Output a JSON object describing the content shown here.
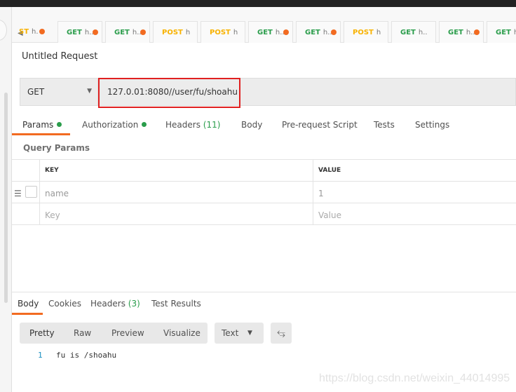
{
  "tabs": [
    {
      "method": "ST",
      "url": "h.",
      "dot": true,
      "type": "post"
    },
    {
      "method": "GET",
      "url": "h...",
      "dot": true,
      "type": "get"
    },
    {
      "method": "GET",
      "url": "h...",
      "dot": true,
      "type": "get"
    },
    {
      "method": "POST",
      "url": "h",
      "dot": false,
      "type": "post"
    },
    {
      "method": "POST",
      "url": "h",
      "dot": false,
      "type": "post"
    },
    {
      "method": "GET",
      "url": "h...",
      "dot": true,
      "type": "get"
    },
    {
      "method": "GET",
      "url": "h...",
      "dot": true,
      "type": "get"
    },
    {
      "method": "POST",
      "url": "h",
      "dot": false,
      "type": "post"
    },
    {
      "method": "GET",
      "url": "h..",
      "dot": false,
      "type": "get"
    },
    {
      "method": "GET",
      "url": "h...",
      "dot": true,
      "type": "get"
    },
    {
      "method": "GET",
      "url": "h",
      "dot": false,
      "type": "get"
    }
  ],
  "request": {
    "title": "Untitled Request",
    "method": "GET",
    "url": "127.0.01:8080//user/fu/shoahu"
  },
  "req_tabs": {
    "params": "Params",
    "authorization": "Authorization",
    "headers": "Headers",
    "headers_count": "(11)",
    "body": "Body",
    "prescript": "Pre-request Script",
    "tests": "Tests",
    "settings": "Settings"
  },
  "query": {
    "title": "Query Params",
    "col_key": "KEY",
    "col_value": "VALUE",
    "rows": [
      {
        "key": "name",
        "value": "1"
      }
    ],
    "key_placeholder": "Key",
    "value_placeholder": "Value"
  },
  "response": {
    "tabs": {
      "body": "Body",
      "cookies": "Cookies",
      "headers": "Headers",
      "headers_count": "(3)",
      "tests": "Test Results"
    },
    "views": {
      "pretty": "Pretty",
      "raw": "Raw",
      "preview": "Preview",
      "visualize": "Visualize"
    },
    "format": "Text",
    "lines": [
      {
        "n": "1",
        "text": "fu is /shoahu"
      }
    ]
  },
  "watermark": "https://blog.csdn.net/weixin_44014995",
  "colors": {
    "accent": "#f26b21",
    "get": "#2a9d4b",
    "post": "#f8b200",
    "highlight": "#e02020"
  }
}
